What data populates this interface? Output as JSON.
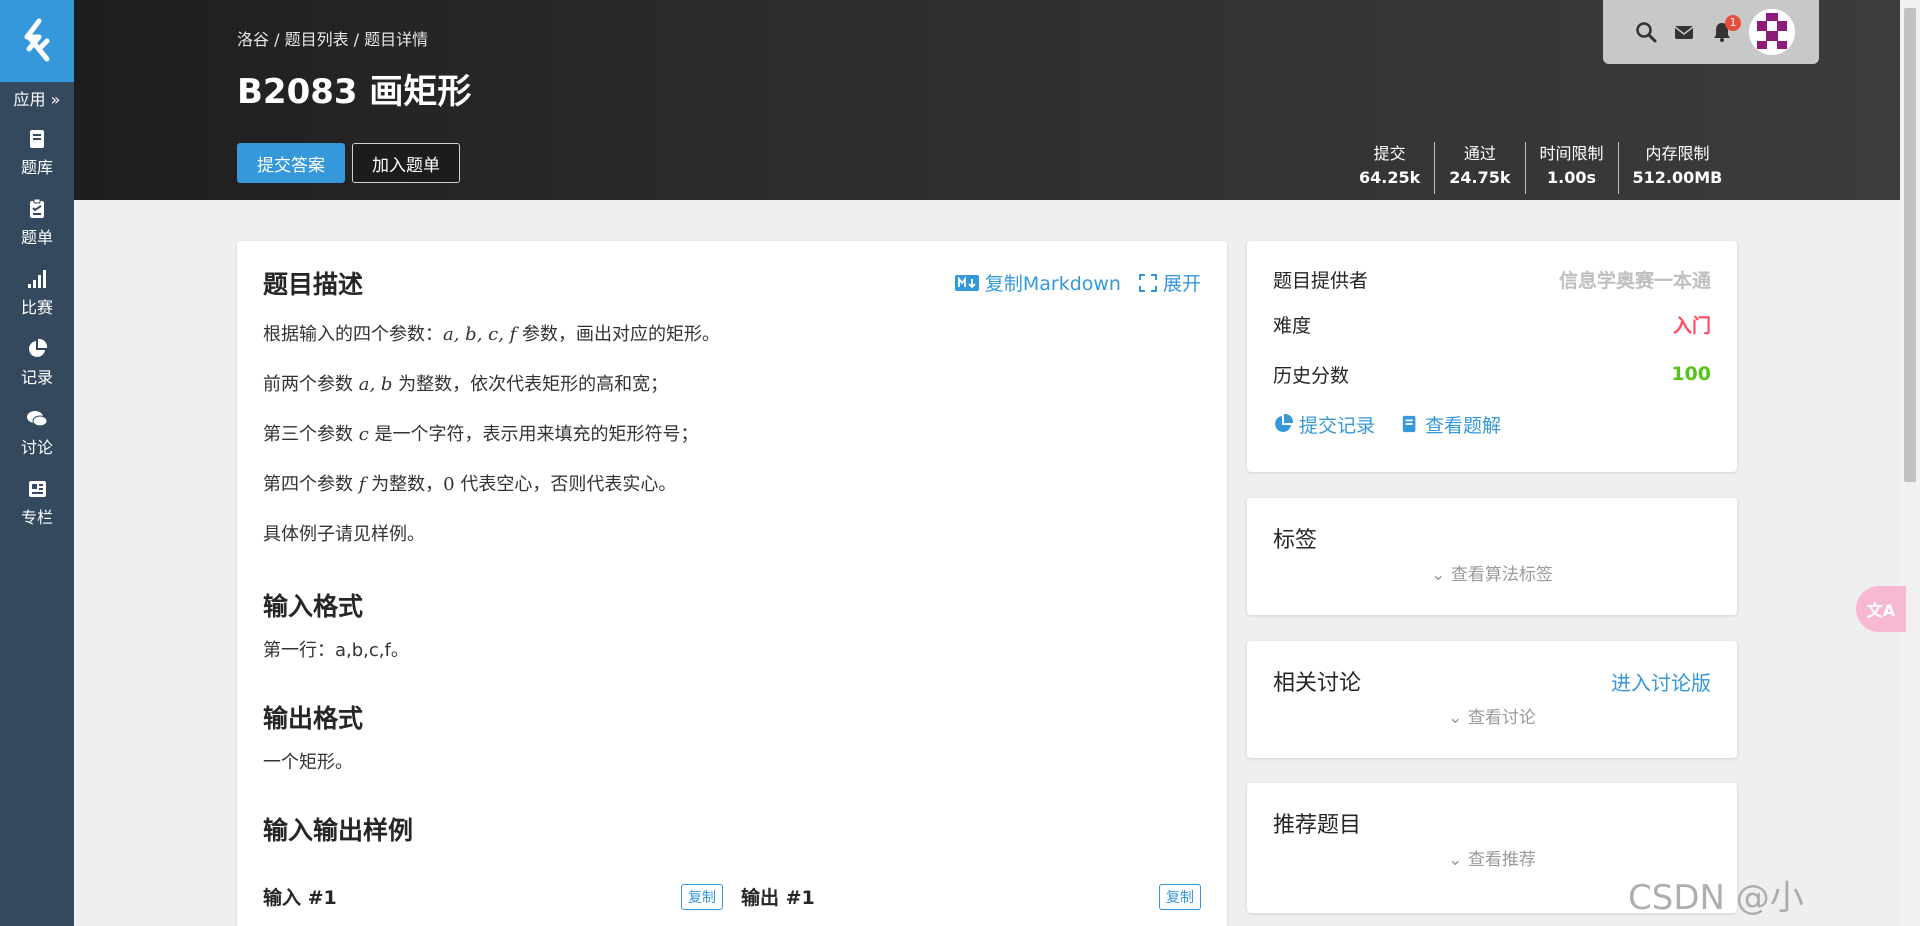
{
  "sidebar": {
    "app_label": "应用 »",
    "items": [
      {
        "label": "题库",
        "icon": "book-icon"
      },
      {
        "label": "题单",
        "icon": "clipboard-icon"
      },
      {
        "label": "比赛",
        "icon": "signal-icon"
      },
      {
        "label": "记录",
        "icon": "pie-icon"
      },
      {
        "label": "讨论",
        "icon": "comments-icon"
      },
      {
        "label": "专栏",
        "icon": "newspaper-icon"
      }
    ]
  },
  "header": {
    "breadcrumb": "洛谷 / 题目列表 / 题目详情",
    "title": "B2083 画矩形",
    "submit_label": "提交答案",
    "add_label": "加入题单",
    "stats": [
      {
        "label": "提交",
        "value": "64.25k"
      },
      {
        "label": "通过",
        "value": "24.75k"
      },
      {
        "label": "时间限制",
        "value": "1.00s"
      },
      {
        "label": "内存限制",
        "value": "512.00MB"
      }
    ],
    "notification_count": "1"
  },
  "problem": {
    "desc_title": "题目描述",
    "copy_markdown": "复制Markdown",
    "expand": "展开",
    "paragraphs": {
      "p1_pre": "根据输入的四个参数：",
      "p1_math": "a, b, c, f",
      "p1_post": " 参数，画出对应的矩形。",
      "p2_pre": "前两个参数 ",
      "p2_math": "a, b",
      "p2_post": " 为整数，依次代表矩形的高和宽；",
      "p3_pre": "第三个参数 ",
      "p3_math": "c",
      "p3_post": " 是一个字符，表示用来填充的矩形符号；",
      "p4_pre": "第四个参数 ",
      "p4_math": "f",
      "p4_mid": " 为整数，",
      "p4_math2": "0",
      "p4_post": " 代表空心，否则代表实心。",
      "p5": "具体例子请见样例。"
    },
    "input_title": "输入格式",
    "input_text": "第一行：a,b,c,f。",
    "output_title": "输出格式",
    "output_text": "一个矩形。",
    "sample_title": "输入输出样例",
    "sample_input": "输入 #1",
    "sample_output": "输出 #1",
    "copy_label": "复制"
  },
  "info": {
    "provider_k": "题目提供者",
    "provider_v": "信息学奥赛一本通",
    "difficulty_k": "难度",
    "difficulty_v": "入门",
    "score_k": "历史分数",
    "score_v": "100",
    "records_link": "提交记录",
    "solutions_link": "查看题解"
  },
  "tags_card": {
    "title": "标签",
    "sub": "查看算法标签"
  },
  "discuss_card": {
    "title": "相关讨论",
    "link": "进入讨论版",
    "sub": "查看讨论"
  },
  "recommend_card": {
    "title": "推荐题目",
    "sub": "查看推荐"
  },
  "translate_label": "文A",
  "watermark": "CSDN @小",
  "colors": {
    "accent": "#3498db",
    "sidebar": "#34495e",
    "difficulty": "#fe4c61",
    "score": "#52c41a",
    "provider": "#bfbfbf"
  }
}
